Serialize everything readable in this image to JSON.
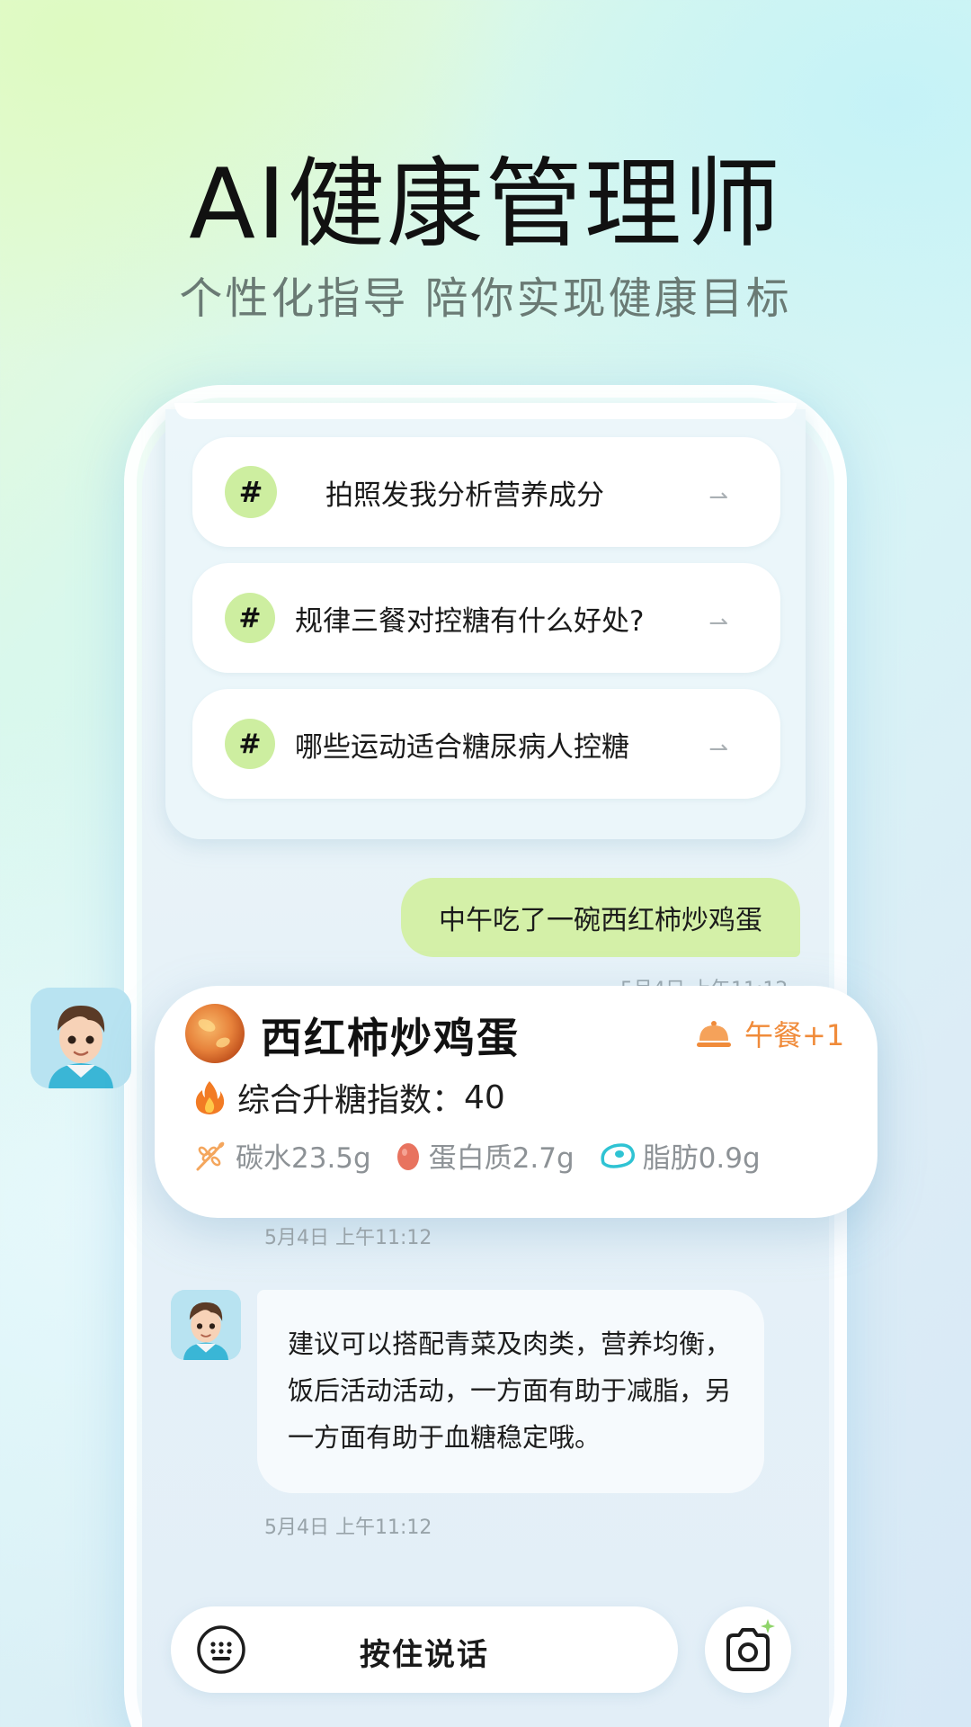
{
  "hero": {
    "title": "AI健康管理师",
    "subtitle": "个性化指导 陪你实现健康目标"
  },
  "suggestions": [
    {
      "label": "拍照发我分析营养成分",
      "icon": "hashtag-icon"
    },
    {
      "label": "规律三餐对控糖有什么好处?",
      "icon": "hashtag-icon"
    },
    {
      "label": "哪些运动适合糖尿病人控糖",
      "icon": "hashtag-icon"
    }
  ],
  "chat": {
    "user_message": "中午吃了一碗西红柿炒鸡蛋",
    "user_time_partial": "5月4日 上午11:12",
    "food_card": {
      "name": "西红柿炒鸡蛋",
      "meal_tag": "午餐+1",
      "gi_label": "综合升糖指数：",
      "gi_value": "40",
      "carbs": "碳水23.5g",
      "protein": "蛋白质2.7g",
      "fat": "脂肪0.9g"
    },
    "card_time": "5月4日 上午11:12",
    "bot_message": "建议可以搭配青菜及肉类，营养均衡，饭后活动活动，一方面有助于减脂，另一方面有助于血糖稳定哦。",
    "bot_time": "5月4日 上午11:12"
  },
  "input": {
    "voice_label": "按住说话"
  },
  "colors": {
    "accent_green": "#cdeea0",
    "user_bubble": "#d4f0a8",
    "meal_orange": "#f08b3a",
    "fat_teal": "#2fc3d3"
  }
}
